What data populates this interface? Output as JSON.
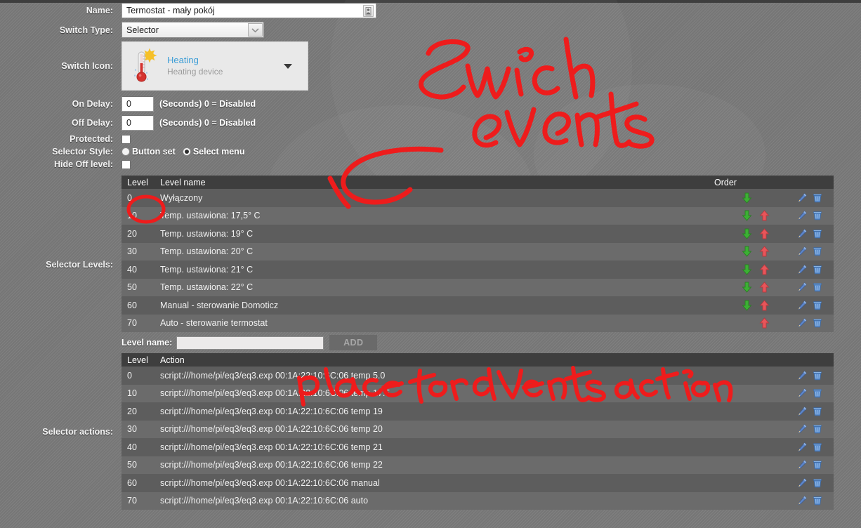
{
  "form": {
    "name": {
      "label": "Name:",
      "value": "Termostat - mały pokój",
      "autofill_icon": "form-autofill-icon"
    },
    "switch_type": {
      "label": "Switch Type:",
      "value": "Selector"
    },
    "switch_icon": {
      "label": "Switch Icon:",
      "title": "Heating",
      "subtitle": "Heating device",
      "icon": "thermometer-sun-icon"
    },
    "on_delay": {
      "label": "On Delay:",
      "value": "0",
      "hint": "(Seconds) 0 = Disabled"
    },
    "off_delay": {
      "label": "Off Delay:",
      "value": "0",
      "hint": "(Seconds) 0 = Disabled"
    },
    "protected": {
      "label": "Protected:",
      "checked": false
    },
    "selector_style": {
      "label": "Selector Style:",
      "options": [
        "Button set",
        "Select menu"
      ],
      "selected": "Select menu"
    },
    "hide_off_level": {
      "label": "Hide Off level:",
      "checked": false
    }
  },
  "selector_levels": {
    "label": "Selector Levels:",
    "columns": [
      "Level",
      "Level name",
      "Order",
      ""
    ],
    "rows": [
      {
        "level": "0",
        "name": "Wyłączony",
        "down": true,
        "up": false
      },
      {
        "level": "10",
        "name": "Temp. ustawiona: 17,5° C",
        "down": true,
        "up": true
      },
      {
        "level": "20",
        "name": "Temp. ustawiona: 19° C",
        "down": true,
        "up": true
      },
      {
        "level": "30",
        "name": "Temp. ustawiona: 20° C",
        "down": true,
        "up": true
      },
      {
        "level": "40",
        "name": "Temp. ustawiona: 21° C",
        "down": true,
        "up": true
      },
      {
        "level": "50",
        "name": "Temp. ustawiona: 22° C",
        "down": true,
        "up": true
      },
      {
        "level": "60",
        "name": "Manual - sterowanie Domoticz",
        "down": true,
        "up": true
      },
      {
        "level": "70",
        "name": "Auto - sterowanie termostat",
        "down": false,
        "up": true
      }
    ],
    "add": {
      "label": "Level name:",
      "value": "",
      "placeholder": "",
      "button": "ADD"
    }
  },
  "selector_actions": {
    "label": "Selector actions:",
    "columns": [
      "Level",
      "Action",
      ""
    ],
    "rows": [
      {
        "level": "0",
        "action": "script:///home/pi/eq3/eq3.exp 00:1A:22:10:6C:06 temp 5.0"
      },
      {
        "level": "10",
        "action": "script:///home/pi/eq3/eq3.exp 00:1A:22:10:6C:06 temp 17.5"
      },
      {
        "level": "20",
        "action": "script:///home/pi/eq3/eq3.exp 00:1A:22:10:6C:06 temp 19"
      },
      {
        "level": "30",
        "action": "script:///home/pi/eq3/eq3.exp 00:1A:22:10:6C:06 temp 20"
      },
      {
        "level": "40",
        "action": "script:///home/pi/eq3/eq3.exp 00:1A:22:10:6C:06 temp 21"
      },
      {
        "level": "50",
        "action": "script:///home/pi/eq3/eq3.exp 00:1A:22:10:6C:06 temp 22"
      },
      {
        "level": "60",
        "action": "script:///home/pi/eq3/eq3.exp 00:1A:22:10:6C:06 manual"
      },
      {
        "level": "70",
        "action": "script:///home/pi/eq3/eq3.exp 00:1A:22:10:6C:06 auto"
      }
    ]
  },
  "icons": {
    "edit": "pencil-icon",
    "delete": "trash-icon",
    "move_down": "arrow-down-icon",
    "move_up": "arrow-up-icon"
  },
  "annotations": {
    "color": "#ee1c1c",
    "items": [
      {
        "text": "Swich events",
        "note": "handwriting top-right"
      },
      {
        "text": "place for events action",
        "note": "handwriting over actions table"
      },
      {
        "text": "",
        "note": "circle around level 0"
      },
      {
        "text": "",
        "note": "arrow pointing to levels table"
      }
    ]
  },
  "colors": {
    "accent_blue": "#3c9dd6",
    "header_bg": "#3e3e3e",
    "row_odd": "#5d5d5d",
    "row_even": "#6b6b6b",
    "annotation_red": "#ee1c1c",
    "arrow_down_green": "#3cb034",
    "arrow_up_red": "#e8555a"
  }
}
